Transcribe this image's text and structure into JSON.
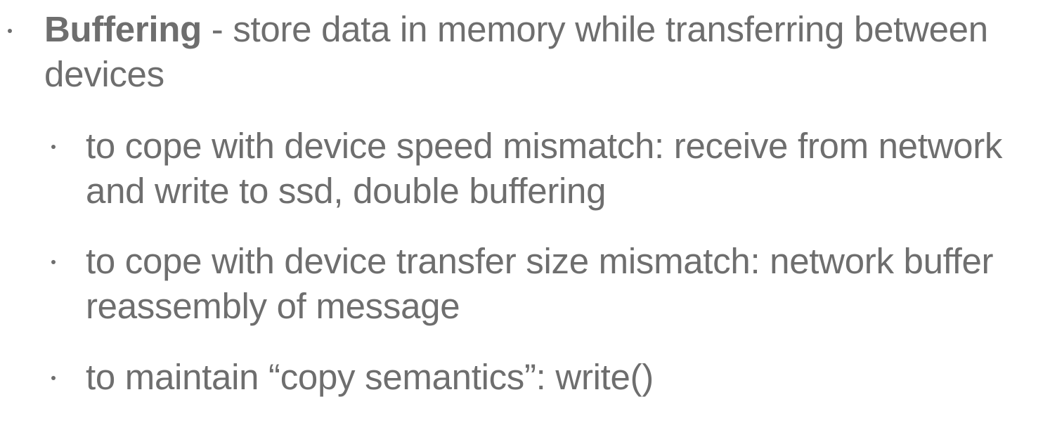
{
  "main_bullet": {
    "term": "Buffering",
    "description": " - store data in memory while transferring between devices"
  },
  "sub_bullets": [
    {
      "text": "to cope with device speed mismatch: receive from network and write to ssd, double buffering"
    },
    {
      "text": "to cope with device transfer size mismatch: network buffer reassembly of message"
    },
    {
      "text": "to maintain “copy semantics”: write()"
    }
  ]
}
